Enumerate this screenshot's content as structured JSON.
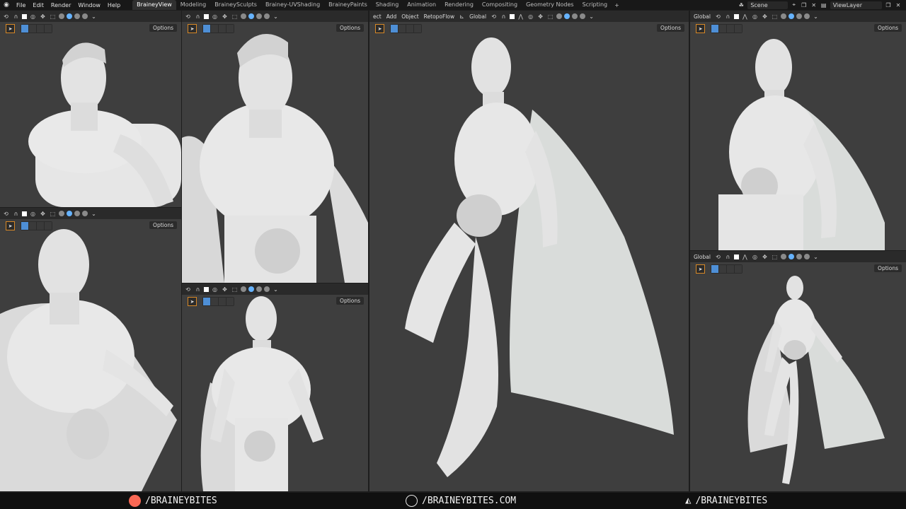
{
  "menus": [
    "File",
    "Edit",
    "Render",
    "Window",
    "Help"
  ],
  "tabs": [
    "BraineyView",
    "Modeling",
    "BraineySculpts",
    "Brainey-UVShading",
    "BraineyPaints",
    "Shading",
    "Animation",
    "Rendering",
    "Compositing",
    "Geometry Nodes",
    "Scripting"
  ],
  "tab_add": "+",
  "scene": "Scene",
  "view_layer": "ViewLayer",
  "options_label": "Options",
  "center_menu": [
    "ect",
    "Add",
    "Object",
    "RetopoFlow"
  ],
  "orientation": "Global",
  "footer": {
    "left": "/BRAINEYBITES",
    "center": "/BRAINEYBITES.COM",
    "right": "/BRAINEYBITES"
  },
  "colors": {
    "accent": "#4e8fd6",
    "viewport_bg": "#3e3e3e",
    "patreon": "#f96854"
  }
}
